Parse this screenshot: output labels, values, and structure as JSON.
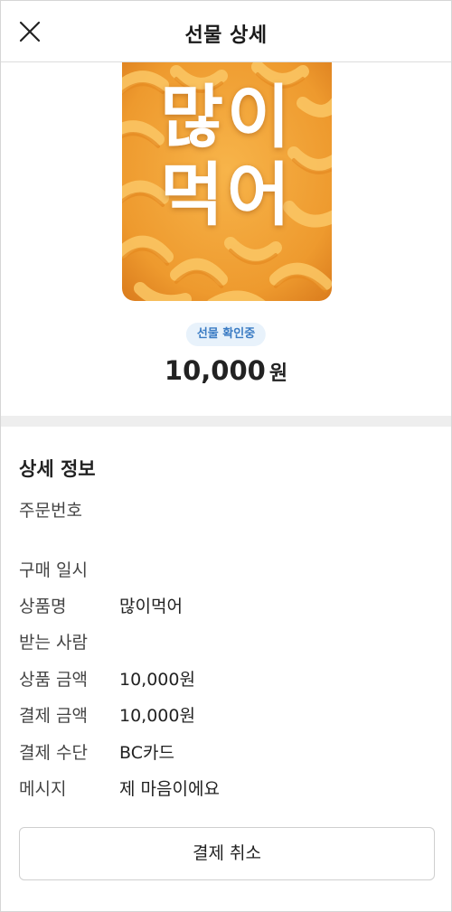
{
  "header": {
    "title": "선물 상세",
    "close_icon": "close-icon"
  },
  "product": {
    "image_text_line1": "많이",
    "image_text_line2": "먹어",
    "status": "선물 확인중",
    "price_amount": "10,000",
    "price_unit": "원"
  },
  "details": {
    "section_title": "상세 정보",
    "order_number_label": "주문번호",
    "rows": [
      {
        "label": "구매 일시",
        "value": ""
      },
      {
        "label": "상품명",
        "value": "많이먹어"
      },
      {
        "label": "받는 사람",
        "value": ""
      },
      {
        "label": "상품 금액",
        "value": "10,000원"
      },
      {
        "label": "결제 금액",
        "value": "10,000원"
      },
      {
        "label": "결제 수단",
        "value": "BC카드"
      },
      {
        "label": "메시지",
        "value": "제 마음이에요"
      }
    ]
  },
  "actions": {
    "cancel_label": "결제 취소"
  },
  "colors": {
    "status_bg": "#e8f2fb",
    "status_text": "#3b7cc4",
    "divider": "#eeeeee",
    "image_base": "#f2a23a"
  }
}
